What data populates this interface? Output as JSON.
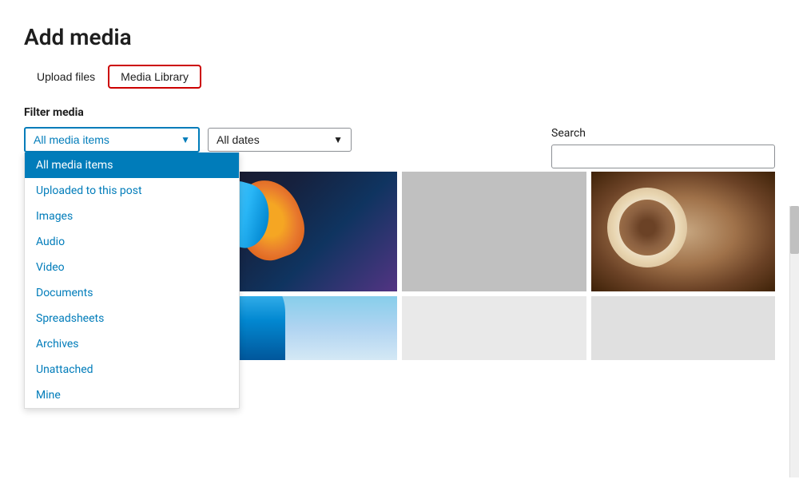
{
  "page": {
    "title": "Add media"
  },
  "tabs": [
    {
      "id": "upload",
      "label": "Upload files",
      "active": false
    },
    {
      "id": "library",
      "label": "Media Library",
      "active": true
    }
  ],
  "filter": {
    "label": "Filter media",
    "media_dropdown": {
      "selected": "All media items",
      "options": [
        {
          "id": "all",
          "label": "All media items",
          "selected": true
        },
        {
          "id": "uploaded",
          "label": "Uploaded to this post",
          "selected": false
        },
        {
          "id": "images",
          "label": "Images",
          "selected": false
        },
        {
          "id": "audio",
          "label": "Audio",
          "selected": false
        },
        {
          "id": "video",
          "label": "Video",
          "selected": false
        },
        {
          "id": "documents",
          "label": "Documents",
          "selected": false
        },
        {
          "id": "spreadsheets",
          "label": "Spreadsheets",
          "selected": false
        },
        {
          "id": "archives",
          "label": "Archives",
          "selected": false
        },
        {
          "id": "unattached",
          "label": "Unattached",
          "selected": false
        },
        {
          "id": "mine",
          "label": "Mine",
          "selected": false
        }
      ]
    },
    "dates_dropdown": {
      "selected": "All dates",
      "options": [
        "All dates"
      ]
    },
    "search": {
      "label": "Search",
      "placeholder": ""
    }
  }
}
